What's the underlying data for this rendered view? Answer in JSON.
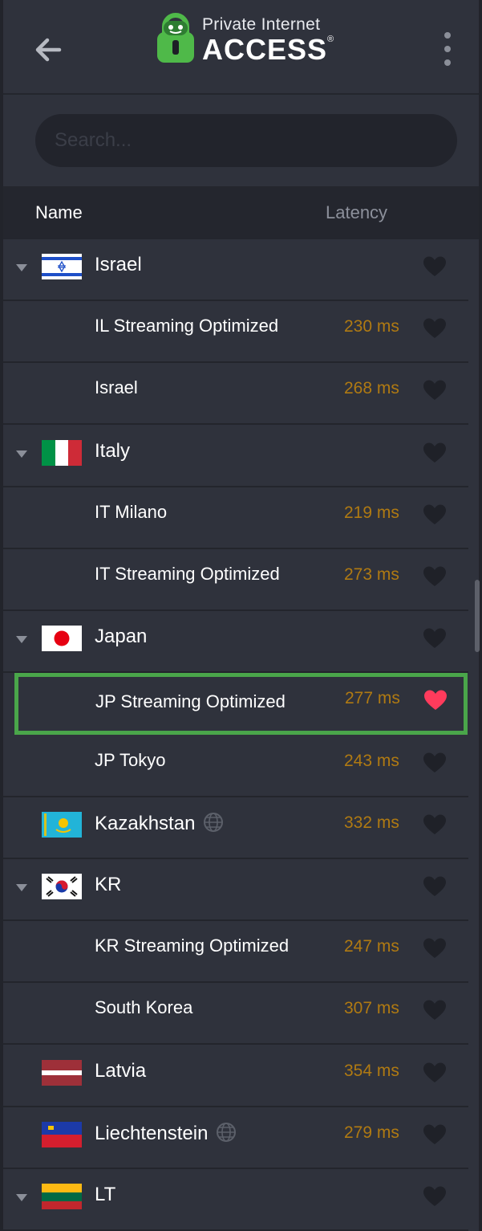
{
  "header": {
    "logo_top": "Private Internet",
    "logo_bottom": "ACCESS",
    "logo_reg": "®",
    "back_icon": "arrow-left-icon",
    "menu_icon": "more-vertical-icon"
  },
  "search": {
    "placeholder": "Search...",
    "value": ""
  },
  "columns": {
    "name": "Name",
    "latency": "Latency"
  },
  "colors": {
    "latency": "#b07a12",
    "heart_favorite": "#ff3b5c",
    "heart_default": "#1f2128",
    "selection_outline": "#4aa64a"
  },
  "regions": [
    {
      "type": "country",
      "name": "Israel",
      "flag": "israel-flag-icon",
      "expanded": true,
      "latency": "",
      "favorite": false
    },
    {
      "type": "server",
      "name": "IL Streaming Optimized",
      "latency": "230 ms",
      "favorite": false
    },
    {
      "type": "server",
      "name": "Israel",
      "latency": "268 ms",
      "favorite": false
    },
    {
      "type": "country",
      "name": "Italy",
      "flag": "italy-flag-icon",
      "expanded": true,
      "latency": "",
      "favorite": false
    },
    {
      "type": "server",
      "name": "IT Milano",
      "latency": "219 ms",
      "favorite": false
    },
    {
      "type": "server",
      "name": "IT Streaming Optimized",
      "latency": "273 ms",
      "favorite": false
    },
    {
      "type": "country",
      "name": "Japan",
      "flag": "japan-flag-icon",
      "expanded": true,
      "latency": "",
      "favorite": false
    },
    {
      "type": "server",
      "name": "JP Streaming Optimized",
      "latency": "277 ms",
      "favorite": true,
      "selected": true
    },
    {
      "type": "server",
      "name": "JP Tokyo",
      "latency": "243 ms",
      "favorite": false
    },
    {
      "type": "country-single",
      "name": "Kazakhstan",
      "flag": "kazakhstan-flag-icon",
      "geo": true,
      "latency": "332 ms",
      "favorite": false
    },
    {
      "type": "country",
      "name": "KR",
      "flag": "korea-flag-icon",
      "expanded": true,
      "latency": "",
      "favorite": false
    },
    {
      "type": "server",
      "name": "KR Streaming Optimized",
      "latency": "247 ms",
      "favorite": false
    },
    {
      "type": "server",
      "name": "South Korea",
      "latency": "307 ms",
      "favorite": false
    },
    {
      "type": "country-single",
      "name": "Latvia",
      "flag": "latvia-flag-icon",
      "latency": "354 ms",
      "favorite": false
    },
    {
      "type": "country-single",
      "name": "Liechtenstein",
      "flag": "liechtenstein-flag-icon",
      "geo": true,
      "latency": "279 ms",
      "favorite": false
    },
    {
      "type": "country",
      "name": "LT",
      "flag": "lithuania-flag-icon",
      "expanded": true,
      "latency": "",
      "favorite": false
    }
  ]
}
